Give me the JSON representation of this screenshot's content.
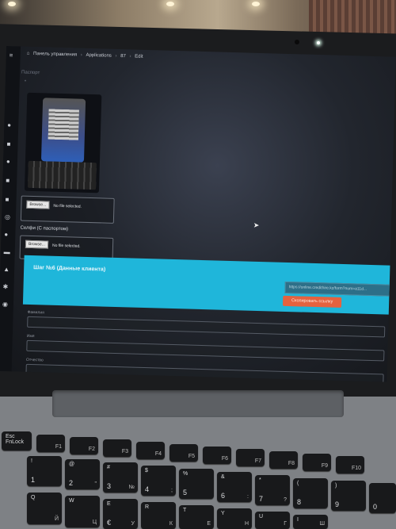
{
  "breadcrumb": [
    "Панель управления",
    "Applications",
    "87",
    "Edit"
  ],
  "page": {
    "title": "Паспорт",
    "star": "*",
    "file_inputs": [
      {
        "button": "Browse...",
        "status": "No file selected."
      },
      {
        "button": "Browse...",
        "status": "No file selected."
      }
    ],
    "selfie_label": "Селфи (С паспортом)"
  },
  "step": {
    "title": "Шаг №6 (Данные клиента)",
    "link_value": "https://online.credithire.kz/form?num=a11d...",
    "copy_button": "Скопировать ссылку"
  },
  "fields": [
    {
      "label": "Фамилия"
    },
    {
      "label": "Имя"
    },
    {
      "label": "Отчество"
    }
  ],
  "keyboard": {
    "fn_row": [
      "Esc FnLock",
      "F1",
      "F2",
      "F3",
      "F4",
      "F5",
      "F6",
      "F7",
      "F8",
      "F9",
      "F10"
    ],
    "num_row": [
      {
        "top": "!",
        "bottom": "1"
      },
      {
        "top": "@",
        "bottom": "2",
        "right": "\""
      },
      {
        "top": "#",
        "bottom": "3",
        "right": "№"
      },
      {
        "top": "$",
        "bottom": "4",
        "right": ";"
      },
      {
        "top": "%",
        "bottom": "5"
      },
      {
        "top": "&",
        "bottom": "6",
        "right": ":"
      },
      {
        "top": "*",
        "bottom": "7",
        "right": "?"
      },
      {
        "top": "(",
        "bottom": "8"
      },
      {
        "top": ")",
        "bottom": "9"
      },
      {
        "top": "",
        "bottom": "0"
      }
    ],
    "letter_row": [
      {
        "top": "Q",
        "right": "Й"
      },
      {
        "top": "W",
        "right": "Ц"
      },
      {
        "top": "E",
        "right": "У",
        "extra": "€"
      },
      {
        "top": "R",
        "right": "К"
      },
      {
        "top": "T",
        "right": "Е"
      },
      {
        "top": "Y",
        "right": "Н"
      },
      {
        "top": "U",
        "right": "Г"
      },
      {
        "top": "I",
        "right": "Ш"
      }
    ]
  }
}
